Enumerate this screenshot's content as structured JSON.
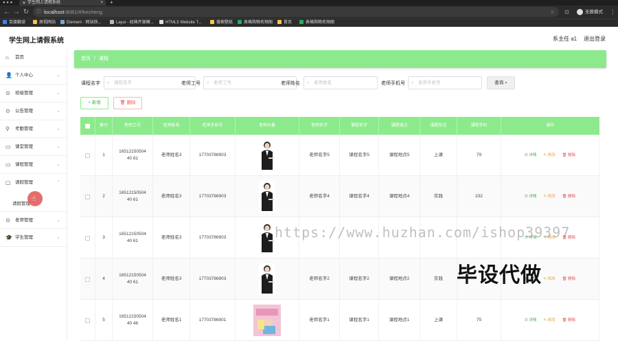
{
  "browser": {
    "tab_title": "学生网上请假系统",
    "url_host": "localhost",
    "url_path": ":8081/#/kecheng",
    "profile_label": "无痕模式",
    "bookmarks": [
      "百度翻译",
      "原视网站",
      "Element - 网站快...",
      "Layui - 经典开源模...",
      "HTML5 Website T...",
      "搜索壁纸",
      "表格购物名频阁",
      "首页",
      "表格购物名频阁"
    ]
  },
  "app": {
    "title": "学生网上请假系统",
    "user_label": "系主任 a1",
    "logout_label": "退出登录"
  },
  "sidebar": {
    "items": [
      {
        "label": "首页",
        "icon": "home-icon"
      },
      {
        "label": "个人中心",
        "icon": "user-icon"
      },
      {
        "label": "班级管理",
        "icon": "class-icon"
      },
      {
        "label": "公告管理",
        "icon": "notice-icon"
      },
      {
        "label": "考勤管理",
        "icon": "attendance-icon"
      },
      {
        "label": "课堂管理",
        "icon": "classroom-icon"
      },
      {
        "label": "课程管理",
        "icon": "course-icon"
      },
      {
        "label": "请假管理",
        "icon": "leave-icon"
      },
      {
        "label": "老师管理",
        "icon": "teacher-icon"
      },
      {
        "label": "学生管理",
        "icon": "student-icon"
      }
    ],
    "sub_item": "请假管理"
  },
  "breadcrumb": {
    "home": "首页",
    "current": "课程"
  },
  "search": {
    "fields": [
      {
        "label": "课程名字",
        "placeholder": "课程名字"
      },
      {
        "label": "老师工号",
        "placeholder": "老师工号"
      },
      {
        "label": "老师姓名",
        "placeholder": "老师姓名"
      },
      {
        "label": "老师手机号",
        "placeholder": "老师手机号"
      }
    ],
    "query_label": "查询"
  },
  "actions": {
    "add_label": "新增",
    "delete_label": "删除"
  },
  "table": {
    "headers": [
      "索引",
      "老师工号",
      "老师姓名",
      "老师手机号",
      "老师头像",
      "老师名字",
      "课程名字",
      "课程地点",
      "课程形式",
      "课程学时",
      "操作"
    ],
    "op_labels": {
      "detail": "详情",
      "edit": "修改",
      "delete": "删除"
    },
    "rows": [
      {
        "index": "1",
        "teacher_no": "1651215050440 81",
        "teacher_name": "老师姓名3",
        "phone": "17703786903",
        "name": "老师名字5",
        "course": "课程名字5",
        "place": "课程地点5",
        "form": "上课",
        "hours": "79"
      },
      {
        "index": "2",
        "teacher_no": "1651215050440 61",
        "teacher_name": "老师姓名3",
        "phone": "17703786903",
        "name": "老师名字4",
        "course": "课程名字4",
        "place": "课程地点4",
        "form": "实践",
        "hours": "232"
      },
      {
        "index": "3",
        "teacher_no": "1651215050440 61",
        "teacher_name": "老师姓名3",
        "phone": "17703786903",
        "name": "",
        "course": "",
        "place": "",
        "form": "",
        "hours": ""
      },
      {
        "index": "4",
        "teacher_no": "1651215050440 61",
        "teacher_name": "老师姓名3",
        "phone": "17703786903",
        "name": "老师名字2",
        "course": "课程名字2",
        "place": "课程地点2",
        "form": "实践",
        "hours": ""
      },
      {
        "index": "5",
        "teacher_no": "1651215050440 46",
        "teacher_name": "老师姓名1",
        "phone": "17703786901",
        "name": "老师名字1",
        "course": "课程名字1",
        "place": "课程地点1",
        "form": "上课",
        "hours": "75"
      }
    ]
  },
  "watermark": {
    "url": "https://www.huzhan.com/ishop39397",
    "text": "毕设代做"
  },
  "colors": {
    "accent": "#8cea8c",
    "danger": "#e45656",
    "warning": "#e6a23c"
  }
}
